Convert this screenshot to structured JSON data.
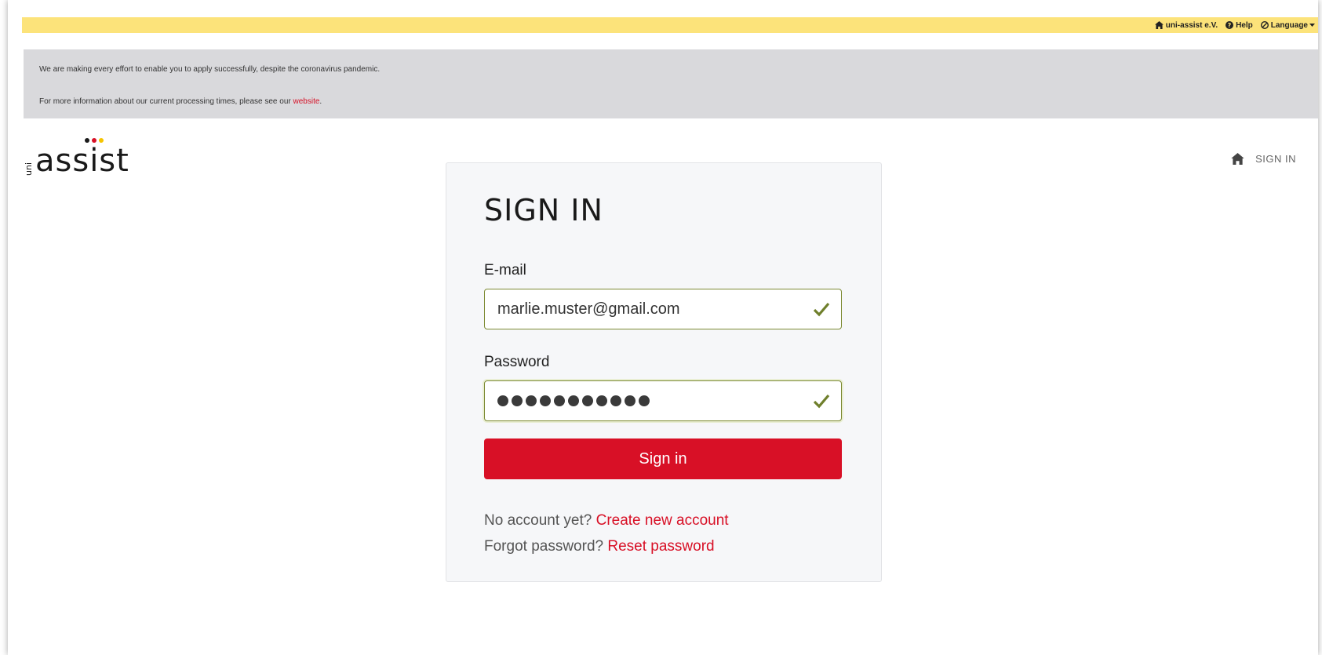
{
  "topbar": {
    "home_link": "uni-assist e.V.",
    "help_link": "Help",
    "language_link": "Language",
    "background_color": "#fce37a"
  },
  "notice": {
    "line1": "We are making every effort to enable you to apply successfully, despite the coronavirus pandemic.",
    "line2_prefix": "For more information about our current processing times, please see our ",
    "line2_link": "website",
    "line2_suffix": ".",
    "background_color": "#d9d9dc"
  },
  "logo": {
    "small_text": "uni",
    "word": "assist",
    "dot_colors": [
      "#1a1a1a",
      "#d81026",
      "#f5c400"
    ]
  },
  "nav": {
    "home_icon": "home-icon",
    "signin_label": "SIGN IN"
  },
  "form": {
    "title": "SIGN IN",
    "email_label": "E-mail",
    "email_value": "marlie.muster@gmail.com",
    "password_label": "Password",
    "password_mask_count": 11,
    "submit_label": "Sign in",
    "no_account_text": "No account yet?",
    "create_account_link": "Create new account",
    "forgot_text": "Forgot password?",
    "reset_link": "Reset password"
  },
  "colors": {
    "accent_red": "#d81026",
    "valid_green": "#7c8a33"
  }
}
